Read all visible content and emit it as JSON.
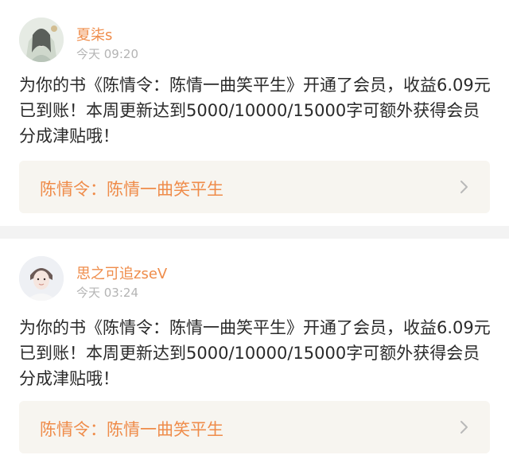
{
  "posts": [
    {
      "username": "夏柒s",
      "time": "今天 09:20",
      "message": "为你的书《陈情令：陈情一曲笑平生》开通了会员，收益6.09元已到账！本周更新达到5000/10000/15000字可额外获得会员分成津贴哦！",
      "book_link": "陈情令：陈情一曲笑平生"
    },
    {
      "username": "思之可追zseV",
      "time": "今天 03:24",
      "message": "为你的书《陈情令：陈情一曲笑平生》开通了会员，收益6.09元已到账！本周更新达到5000/10000/15000字可额外获得会员分成津贴哦！",
      "book_link": "陈情令：陈情一曲笑平生"
    }
  ],
  "colors": {
    "accent": "#ef8c4a",
    "timestamp": "#b4b4b4",
    "link_bg": "#f7f5f0",
    "divider": "#f3f3f3"
  },
  "icons": [
    "avatar",
    "chevron-right-icon"
  ]
}
